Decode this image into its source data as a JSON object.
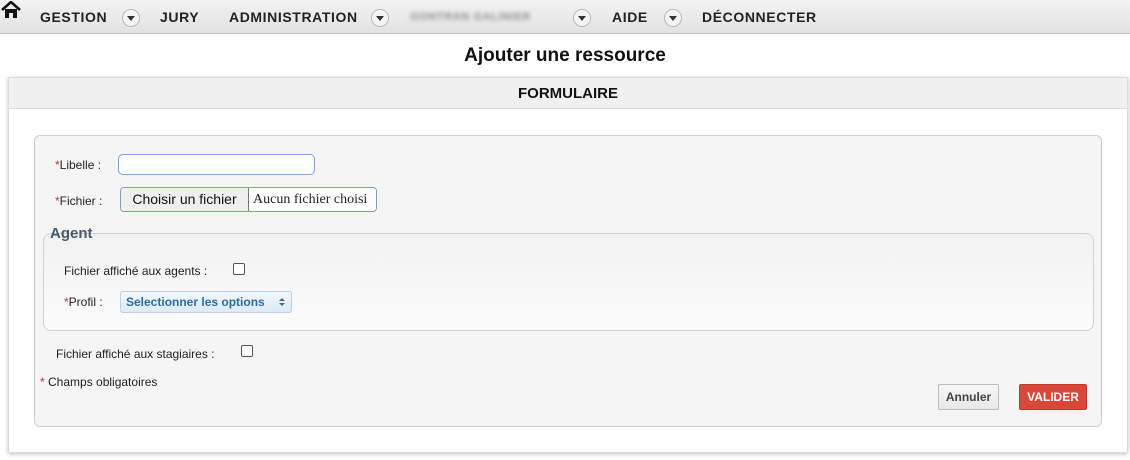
{
  "nav": {
    "items": [
      "GESTION",
      "JURY",
      "ADMINISTRATION",
      "GONTRAN GALINIER",
      "AIDE",
      "DÉCONNECTER"
    ]
  },
  "page": {
    "title": "Ajouter une ressource"
  },
  "panel": {
    "header": "FORMULAIRE"
  },
  "form": {
    "required_mark": "*",
    "libelle_label": "Libelle :",
    "libelle_value": "",
    "fichier_label": "Fichier :",
    "file_button": "Choisir un fichier",
    "file_status": "Aucun fichier choisi",
    "agent_legend": "Agent",
    "agents_checkbox_label": "Fichier affiché aux agents :",
    "profil_label": "Profil :",
    "profil_select": "Selectionner les options",
    "stagiaires_checkbox_label": "Fichier affiché aux stagiaires :",
    "required_note": "Champs obligatoires",
    "cancel_button": "Annuler",
    "submit_button": "VALIDER"
  },
  "colors": {
    "required": "#c0392b",
    "submit_bg": "#d9463a",
    "select_text": "#2d6ca2"
  }
}
